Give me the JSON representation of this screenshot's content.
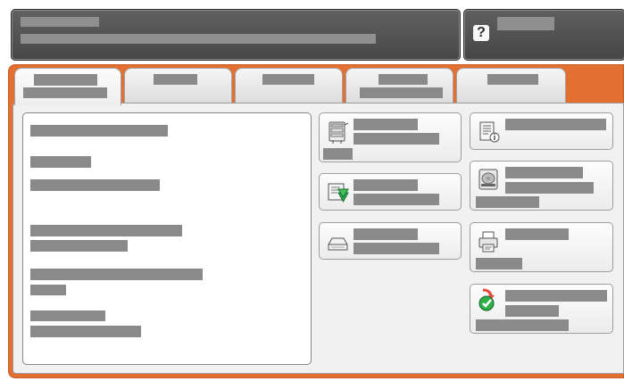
{
  "colors": {
    "accent": "#e36f31",
    "header_bg": "#555555",
    "panel_bg": "#f1f1f1",
    "redaction": "#8a8a8a"
  },
  "header": {
    "title": "",
    "subtitle": ""
  },
  "help": {
    "icon_glyph": "?",
    "label": ""
  },
  "tabs": [
    {
      "label": "",
      "active": true
    },
    {
      "label": "",
      "active": false
    },
    {
      "label": "",
      "active": false
    },
    {
      "label": "",
      "active": false
    },
    {
      "label": "",
      "active": false
    }
  ],
  "info_panel": {
    "lines": [
      "",
      "",
      "",
      "",
      "",
      "",
      "",
      "",
      ""
    ]
  },
  "actions": [
    {
      "icon": "copier-icon",
      "label": ""
    },
    {
      "icon": "scan-download-icon",
      "label": ""
    },
    {
      "icon": "scanner-icon",
      "label": ""
    },
    {
      "icon": "document-info-icon",
      "label": ""
    },
    {
      "icon": "hard-drive-icon",
      "label": ""
    },
    {
      "icon": "printer-icon",
      "label": ""
    },
    {
      "icon": "update-check-icon",
      "label": ""
    }
  ]
}
